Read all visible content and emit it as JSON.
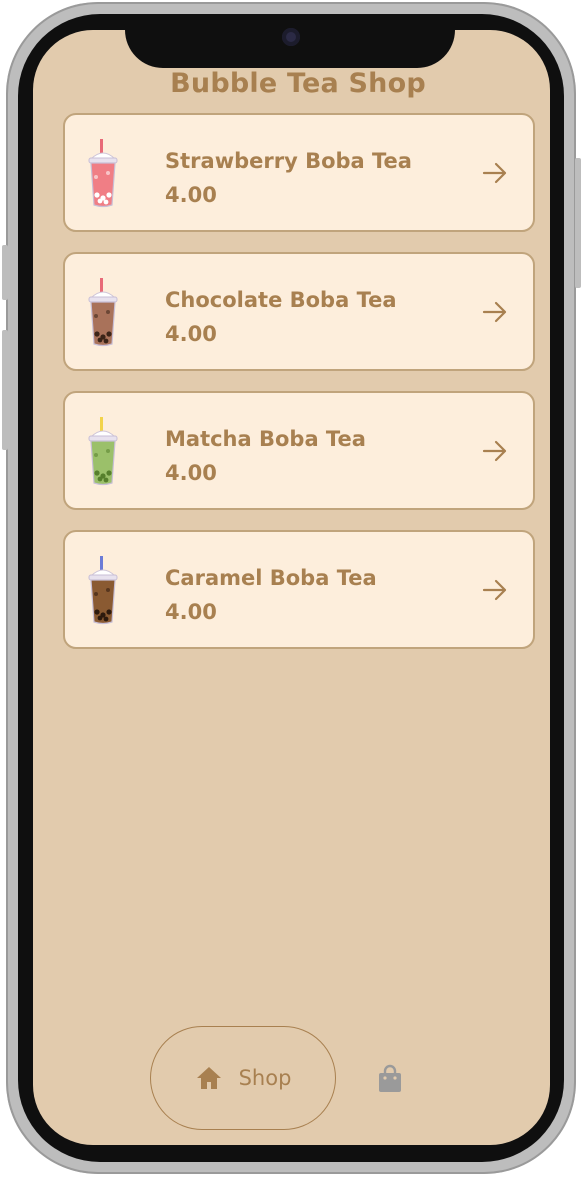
{
  "app": {
    "title": "Bubble Tea Shop"
  },
  "menu": {
    "items": [
      {
        "name": "Strawberry Boba Tea",
        "price": "4.00",
        "tea_color": "#f07e85",
        "straw_color": "#e86a78",
        "pearl_color": "#ffffff"
      },
      {
        "name": "Chocolate Boba Tea",
        "price": "4.00",
        "tea_color": "#a9725a",
        "straw_color": "#e86a78",
        "pearl_color": "#3b2418"
      },
      {
        "name": "Matcha Boba Tea",
        "price": "4.00",
        "tea_color": "#9bc06a",
        "straw_color": "#f2d34a",
        "pearl_color": "#567f2c"
      },
      {
        "name": "Caramel Boba Tea",
        "price": "4.00",
        "tea_color": "#8a5a32",
        "straw_color": "#6b7bd6",
        "pearl_color": "#2d1a0e"
      }
    ],
    "item_icon": "arrow-right-icon"
  },
  "nav": {
    "shop_label": "Shop",
    "shop_icon": "home-icon",
    "cart_icon": "shopping-bag-icon"
  },
  "colors": {
    "background": "#e2cbad",
    "card": "#fdeedc",
    "accent": "#a88050",
    "inactive_icon": "#9a9a9a"
  }
}
